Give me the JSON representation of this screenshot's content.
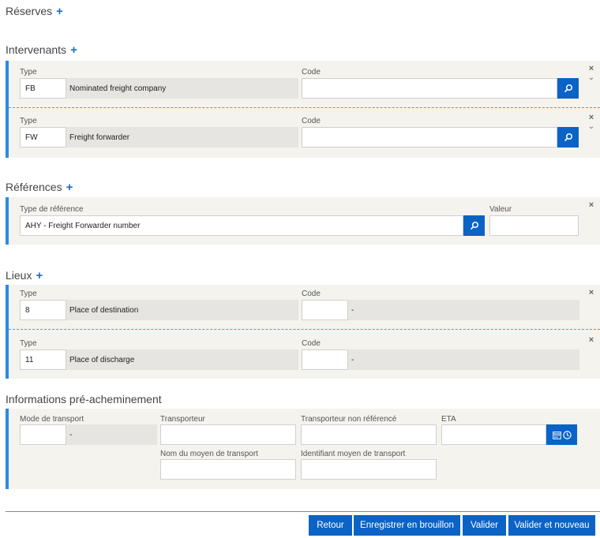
{
  "sections": {
    "reserves": {
      "title": "Réserves",
      "add": "+"
    },
    "intervenants": {
      "title": "Intervenants",
      "add": "+",
      "type_label": "Type",
      "code_label": "Code",
      "rows": [
        {
          "type_code": "FB",
          "type_desc": "Nominated freight company",
          "code": ""
        },
        {
          "type_code": "FW",
          "type_desc": "Freight forwarder",
          "code": ""
        }
      ]
    },
    "references": {
      "title": "Références",
      "add": "+",
      "type_label": "Type de référence",
      "value_label": "Valeur",
      "row": {
        "type": "AHY - Freight Forwarder number",
        "value": ""
      }
    },
    "lieux": {
      "title": "Lieux",
      "add": "+",
      "type_label": "Type",
      "code_label": "Code",
      "rows": [
        {
          "type_code": "8",
          "type_desc": "Place of destination",
          "code": "",
          "code_desc": "-"
        },
        {
          "type_code": "11",
          "type_desc": "Place of discharge",
          "code": "",
          "code_desc": "-"
        }
      ]
    },
    "pre_acheminement": {
      "title": "Informations pré-acheminement",
      "mode_label": "Mode de transport",
      "mode_value": "",
      "mode_desc": "-",
      "transporteur_label": "Transporteur",
      "transporteur_value": "",
      "non_ref_label": "Transporteur non référencé",
      "non_ref_value": "",
      "eta_label": "ETA",
      "eta_value": "",
      "nom_moyen_label": "Nom du moyen de transport",
      "nom_moyen_value": "",
      "id_moyen_label": "Identifiant moyen de transport",
      "id_moyen_value": ""
    }
  },
  "controls": {
    "close": "×",
    "down": "⌄"
  },
  "actions": {
    "retour": "Retour",
    "brouillon": "Enregistrer en brouillon",
    "valider": "Valider",
    "valider_nouveau": "Valider et nouveau"
  },
  "colors": {
    "accent": "#2b8be0",
    "button": "#0b63c6",
    "panel": "#f4f3ee"
  },
  "icons": {
    "search": "search-icon",
    "calendar": "calendar-icon",
    "clock": "clock-icon"
  }
}
